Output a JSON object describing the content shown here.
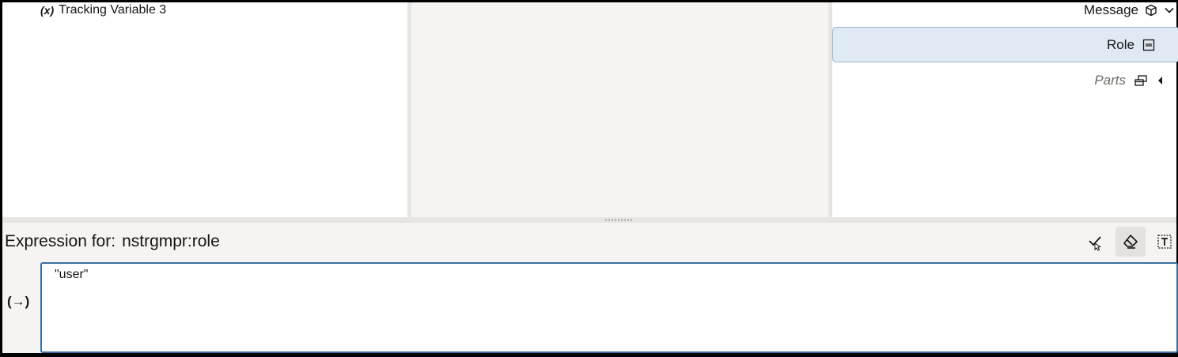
{
  "left_tree": {
    "item": {
      "icon_text": "(x)",
      "label": "Tracking Variable 3"
    }
  },
  "right_tree": {
    "message": {
      "label": "Message",
      "icon": "cube-icon",
      "toggle_icon": "chevron-down-icon"
    },
    "role": {
      "label": "Role",
      "icon": "string-type-icon"
    },
    "parts": {
      "label": "Parts",
      "icon": "parts-icon",
      "toggle_icon": "caret-left-icon"
    }
  },
  "expression": {
    "prefix": "Expression for:",
    "target": "nstrgmpr:role",
    "value": "\"user\"",
    "namespace_icon_text": "(→)",
    "tools": {
      "validate_icon": "checkmark-icon",
      "clear_icon": "eraser-icon",
      "format_icon": "text-format-icon"
    }
  },
  "colors": {
    "selected_bg": "#dfeaf4",
    "input_border": "#3b6fa0",
    "panel_bg": "#f5f4f2"
  }
}
